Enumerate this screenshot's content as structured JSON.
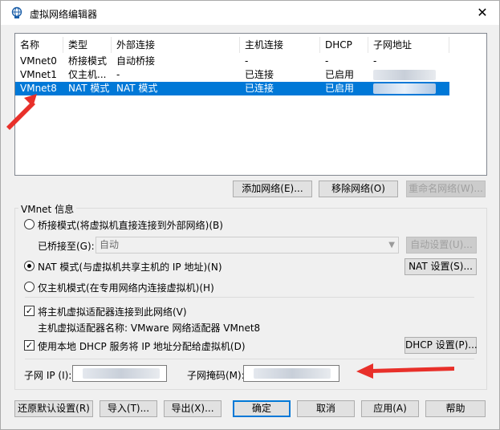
{
  "window": {
    "title": "虚拟网络编辑器",
    "close_glyph": "✕"
  },
  "list": {
    "headers": [
      "名称",
      "类型",
      "外部连接",
      "主机连接",
      "DHCP",
      "子网地址"
    ],
    "rows": [
      {
        "name": "VMnet0",
        "type": "桥接模式",
        "external": "自动桥接",
        "host": "-",
        "dhcp": "-",
        "subnet": "-"
      },
      {
        "name": "VMnet1",
        "type": "仅主机...",
        "external": "-",
        "host": "已连接",
        "dhcp": "已启用",
        "subnet": ""
      },
      {
        "name": "VMnet8",
        "type": "NAT 模式",
        "external": "NAT 模式",
        "host": "已连接",
        "dhcp": "已启用",
        "subnet": ""
      }
    ],
    "selected_row": 2
  },
  "list_buttons": {
    "add": "添加网络(E)...",
    "remove": "移除网络(O)",
    "rename": "重命名网络(W)..."
  },
  "vmnet_info": {
    "title": "VMnet 信息",
    "bridge_radio": "桥接模式(将虚拟机直接连接到外部网络)(B)",
    "bridged_to_label": "已桥接至(G):",
    "bridged_to_value": "自动",
    "auto_settings": "自动设置(U)...",
    "nat_radio": "NAT 模式(与虚拟机共享主机的 IP 地址)(N)",
    "nat_settings": "NAT 设置(S)...",
    "hostonly_radio": "仅主机模式(在专用网络内连接虚拟机)(H)",
    "connect_adapter": "将主机虚拟适配器连接到此网络(V)",
    "adapter_name": "主机虚拟适配器名称: VMware 网络适配器 VMnet8",
    "use_dhcp": "使用本地 DHCP 服务将 IP 地址分配给虚拟机(D)",
    "dhcp_settings": "DHCP 设置(P)...",
    "subnet_ip_label": "子网 IP (I):",
    "subnet_mask_label": "子网掩码(M):",
    "selected_mode": "nat",
    "connect_adapter_checked": true,
    "use_dhcp_checked": true
  },
  "footer": {
    "restore": "还原默认设置(R)",
    "import": "导入(T)...",
    "export": "导出(X)...",
    "ok": "确定",
    "cancel": "取消",
    "apply": "应用(A)",
    "help": "帮助"
  },
  "colors": {
    "selection": "#0078d7",
    "annotation_arrow": "#e8302a"
  }
}
